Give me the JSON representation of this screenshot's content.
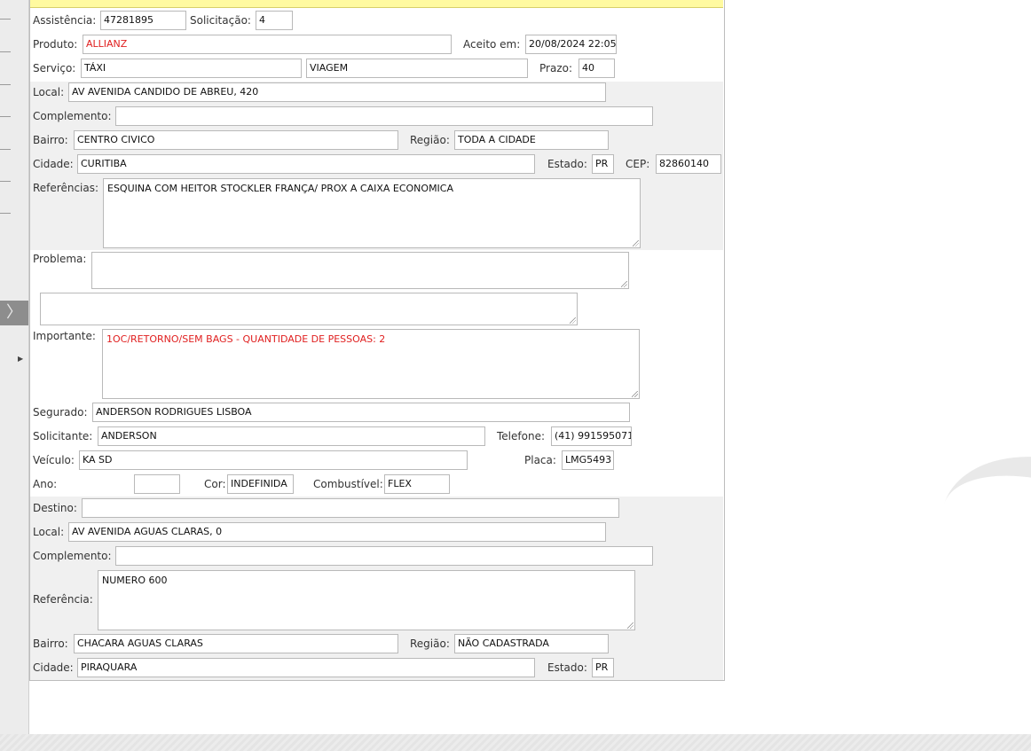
{
  "header": {
    "assistencia_label": "Assistência:",
    "assistencia": "47281895",
    "solicitacao_label": "Solicitação:",
    "solicitacao": "4",
    "produto_label": "Produto:",
    "produto": "ALLIANZ",
    "aceito_label": "Aceito em:",
    "aceito": "20/08/2024 22:05",
    "servico_label": "Serviço:",
    "servico": "TÁXI",
    "servico_tipo": "VIAGEM",
    "prazo_label": "Prazo:",
    "prazo": "40"
  },
  "origem": {
    "local_label": "Local:",
    "local": "AV AVENIDA CANDIDO DE ABREU, 420",
    "complemento_label": "Complemento:",
    "complemento": "",
    "bairro_label": "Bairro:",
    "bairro": "CENTRO CIVICO",
    "regiao_label": "Região:",
    "regiao": "TODA A CIDADE",
    "cidade_label": "Cidade:",
    "cidade": "CURITIBA",
    "estado_label": "Estado:",
    "estado": "PR",
    "cep_label": "CEP:",
    "cep": "82860140",
    "referencias_label": "Referências:",
    "referencias": "ESQUINA COM HEITOR STOCKLER FRANÇA/ PROX A CAIXA ECONOMICA"
  },
  "problema": {
    "label": "Problema:",
    "value": "",
    "extra": "",
    "importante_label": "Importante:",
    "importante": "1OC/RETORNO/SEM BAGS - QUANTIDADE DE PESSOAS: 2"
  },
  "segurado": {
    "segurado_label": "Segurado:",
    "segurado": "ANDERSON RODRIGUES LISBOA",
    "solicitante_label": "Solicitante:",
    "solicitante": "ANDERSON",
    "telefone_label": "Telefone:",
    "telefone": "(41) 991595071",
    "veiculo_label": "Veículo:",
    "veiculo": "KA SD",
    "placa_label": "Placa:",
    "placa": "LMG5493",
    "ano_label": "Ano:",
    "ano": "",
    "cor_label": "Cor:",
    "cor": "INDEFINIDA",
    "combustivel_label": "Combustível:",
    "combustivel": "FLEX"
  },
  "destino": {
    "destino_label": "Destino:",
    "destino": "",
    "local_label": "Local:",
    "local": "AV AVENIDA AGUAS CLARAS, 0",
    "complemento_label": "Complemento:",
    "complemento": "",
    "referencia_label": "Referência:",
    "referencia": "NUMERO 600",
    "bairro_label": "Bairro:",
    "bairro": "CHACARA AGUAS CLARAS",
    "regiao_label": "Região:",
    "regiao": "NÃO CADASTRADA",
    "cidade_label": "Cidade:",
    "cidade": "PIRAQUARA",
    "estado_label": "Estado:",
    "estado": "PR"
  },
  "sidebar": {
    "toggle_icon": "chevron-right-icon",
    "arrow_icon": "triangle-right-icon"
  }
}
